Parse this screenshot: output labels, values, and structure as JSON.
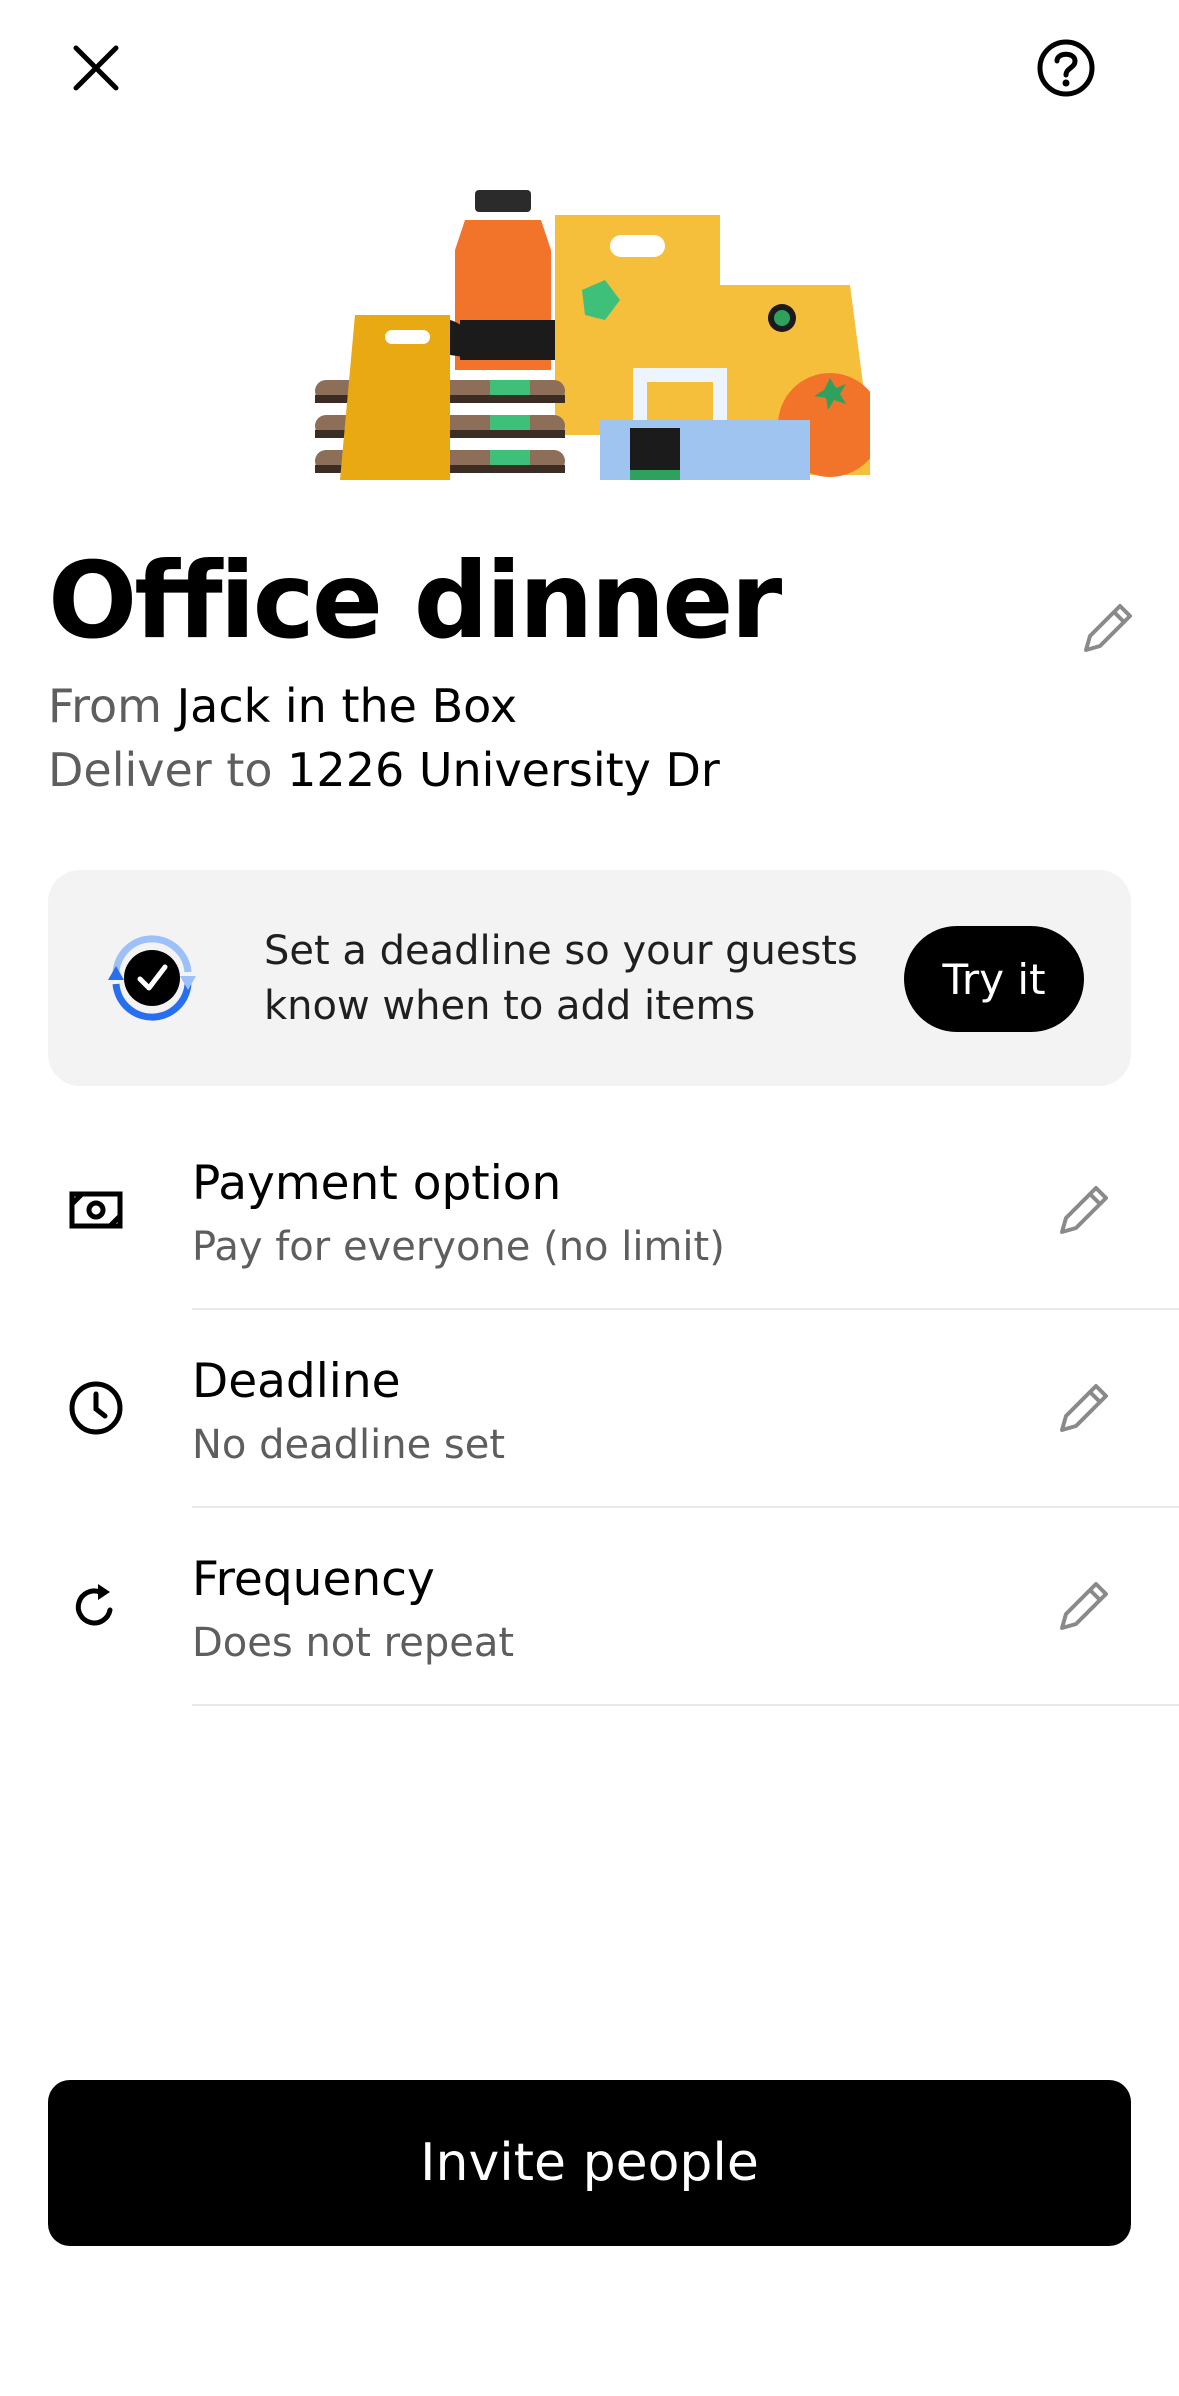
{
  "header": {
    "close_icon": "close-icon",
    "help_icon": "help-icon"
  },
  "order": {
    "title": "Office dinner",
    "from_label": "From",
    "restaurant": "Jack in the Box",
    "deliver_label": "Deliver to",
    "address": "1226 University Dr"
  },
  "promo": {
    "text": "Set a deadline so your guests know when to add items",
    "button_label": "Try it",
    "accent_color": "#276ef1"
  },
  "settings": [
    {
      "title": "Payment option",
      "subtitle": "Pay for everyone (no limit)",
      "icon": "cash-icon"
    },
    {
      "title": "Deadline",
      "subtitle": "No deadline set",
      "icon": "clock-icon"
    },
    {
      "title": "Frequency",
      "subtitle": "Does not repeat",
      "icon": "repeat-icon"
    }
  ],
  "footer": {
    "invite_label": "Invite people"
  }
}
